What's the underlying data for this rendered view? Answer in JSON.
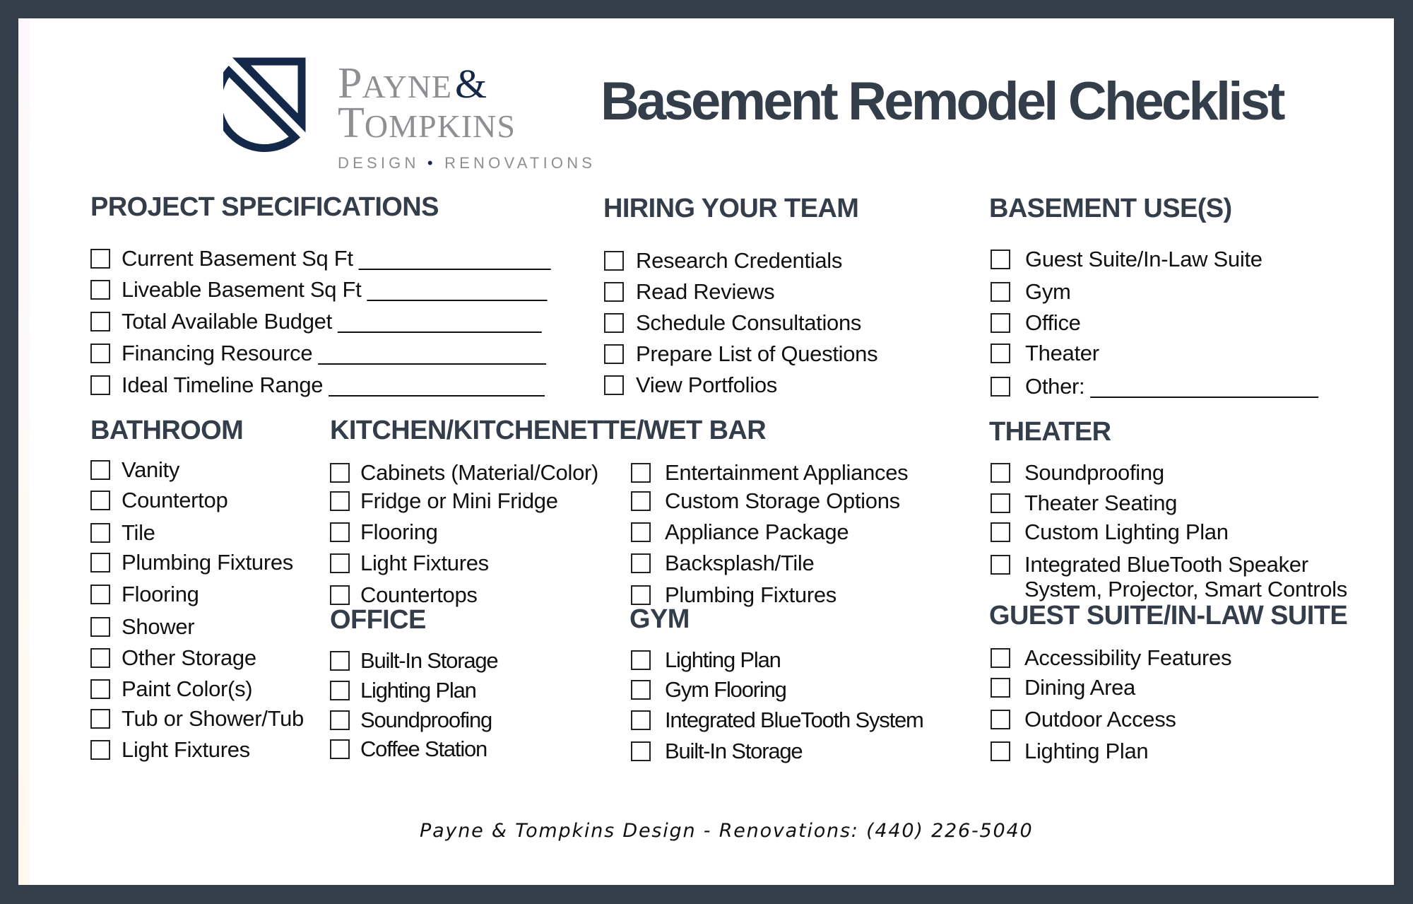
{
  "logo": {
    "word1_first": "P",
    "word1_rest": "AYNE",
    "ampersand": "&",
    "word2_first": "T",
    "word2_rest": "OMPKINS",
    "tag_left": "DESIGN",
    "tag_dot": "•",
    "tag_right": "RENOVATIONS",
    "colors": {
      "navy": "#14294a",
      "gray": "#8d8f93"
    }
  },
  "title": "Basement Remodel Checklist",
  "colors": {
    "frame": "#343e4a",
    "heading": "#343e4a",
    "text": "#111111"
  },
  "sections": {
    "project_specifications": {
      "heading": "PROJECT SPECIFICATIONS",
      "items": [
        "Current Basement Sq Ft ________________",
        "Liveable Basement Sq Ft _______________",
        "Total Available Budget _________________",
        "Financing Resource ___________________",
        "Ideal Timeline Range __________________"
      ]
    },
    "hiring_your_team": {
      "heading": "HIRING YOUR TEAM",
      "items": [
        "Research Credentials",
        "Read Reviews",
        "Schedule Consultations",
        "Prepare List of Questions",
        "View Portfolios"
      ]
    },
    "basement_uses": {
      "heading": "BASEMENT USE(S)",
      "items": [
        "Guest Suite/In-Law Suite",
        "Gym",
        "Office",
        "Theater",
        "Other: ___________________"
      ]
    },
    "bathroom": {
      "heading": "BATHROOM",
      "items": [
        "Vanity",
        "Countertop",
        "Tile",
        "Plumbing Fixtures",
        "Flooring",
        "Shower",
        "Other Storage",
        "Paint Color(s)",
        "Tub or Shower/Tub",
        "Light Fixtures"
      ]
    },
    "kitchen": {
      "heading": "KITCHEN/KITCHENETTE/WET BAR",
      "items_left": [
        "Cabinets (Material/Color)",
        "Fridge or Mini Fridge",
        "Flooring",
        "Light Fixtures",
        "Countertops"
      ],
      "items_right": [
        "Entertainment Appliances",
        "Custom Storage Options",
        "Appliance Package",
        "Backsplash/Tile",
        "Plumbing Fixtures"
      ]
    },
    "office": {
      "heading": "OFFICE",
      "items": [
        "Built-In Storage",
        "Lighting Plan",
        "Soundproofing",
        "Coffee Station"
      ]
    },
    "gym": {
      "heading": "GYM",
      "items": [
        "Lighting Plan",
        "Gym Flooring",
        "Integrated BlueTooth System",
        "Built-In Storage"
      ]
    },
    "theater": {
      "heading": "THEATER",
      "items": [
        "Soundproofing",
        "Theater Seating",
        "Custom Lighting Plan",
        "Integrated BlueTooth Speaker",
        "System, Projector, Smart Controls"
      ]
    },
    "guest_suite": {
      "heading": "GUEST SUITE/IN-LAW SUITE",
      "items": [
        "Accessibility Features",
        "Dining Area",
        "Outdoor Access",
        "Lighting Plan"
      ]
    }
  },
  "footer": "Payne & Tompkins Design - Renovations: (440) 226-5040"
}
